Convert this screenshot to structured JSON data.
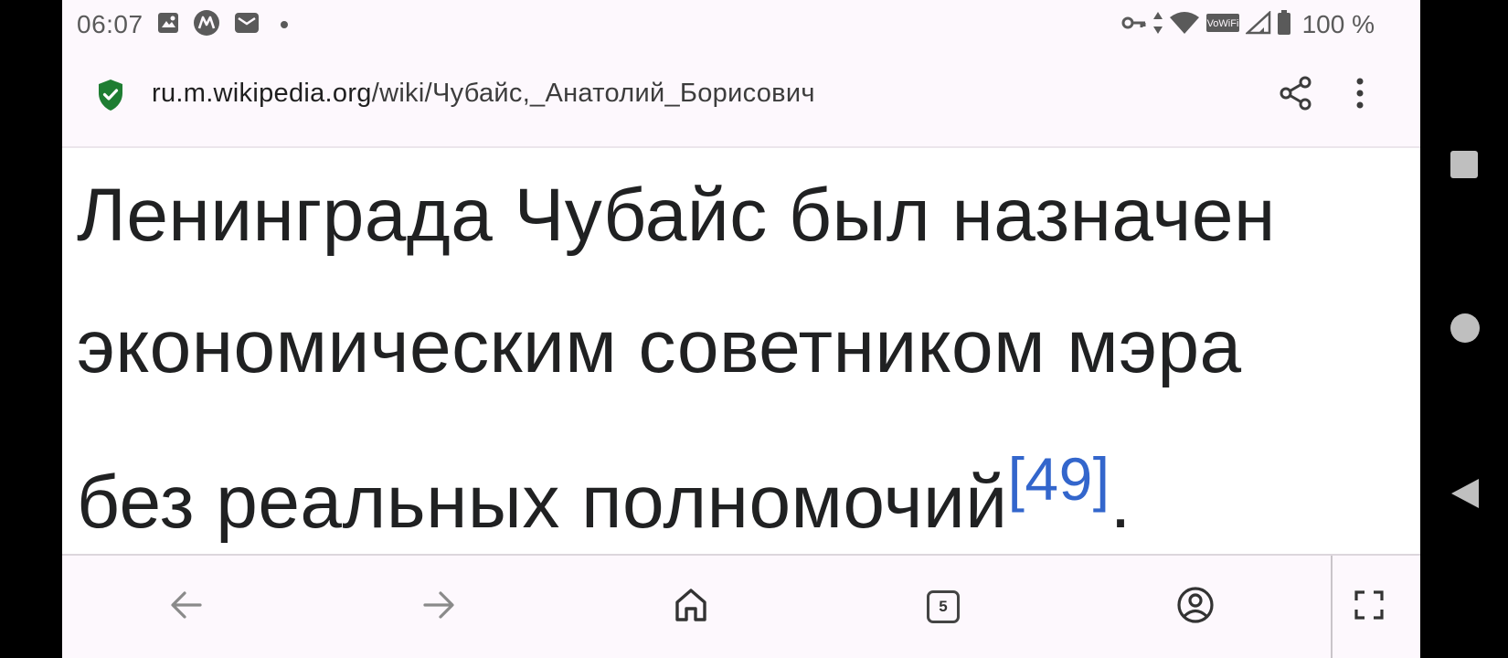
{
  "status_bar": {
    "time": "06:07",
    "battery": "100 %",
    "icons": [
      "image-icon",
      "m-app-icon",
      "mail-icon",
      "notification-dot",
      "vpn-key-icon",
      "data-arrows-icon",
      "wifi-icon",
      "vowifi-icon",
      "signal-icon",
      "battery-icon"
    ],
    "vowifi_label": "VoWiFi"
  },
  "url_bar": {
    "domain": "ru.m.wikipedia.org",
    "path": "/wiki/Чубайс,_Анатолий_Борисович",
    "secure_icon": "shield-check-icon",
    "share_icon": "share-icon",
    "menu_icon": "more-vert-icon"
  },
  "article": {
    "line1": "Ленинграда Чубайс был назначен",
    "line2": "экономическим советником мэра",
    "line3_text": "без реальных полномочий",
    "reference": "[49]",
    "line3_end": "."
  },
  "bottom_nav": {
    "tab_count": "5",
    "items": [
      "back-icon",
      "forward-icon",
      "home-icon",
      "tabs-icon",
      "account-icon",
      "fullscreen-icon"
    ]
  },
  "colors": {
    "accent_link": "#3366cc",
    "secure_green": "#1e7d32",
    "text": "#202122"
  }
}
